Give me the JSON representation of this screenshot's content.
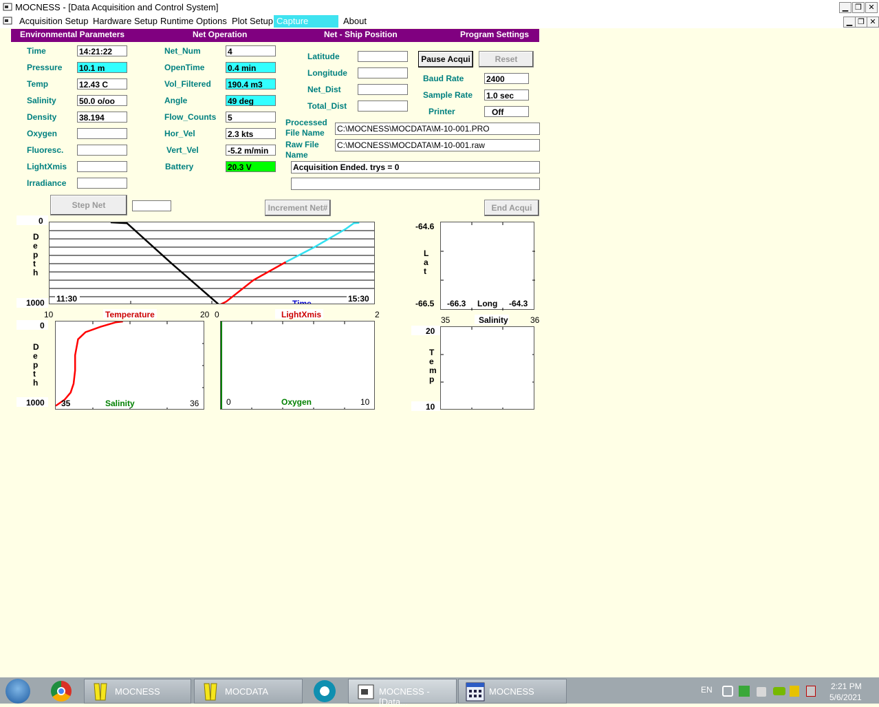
{
  "window": {
    "title": "MOCNESS - [Data Acquisition and Control System]"
  },
  "menu": [
    "Acquisition Setup",
    "Hardware Setup",
    "Runtime Options",
    "Plot Setup",
    "Capture Screen",
    "About"
  ],
  "sections": {
    "env": "Environmental Parameters",
    "net": "Net Operation",
    "ship": "Net - Ship Position",
    "prog": "Program Settings"
  },
  "env": {
    "labels": [
      "Time",
      "Pressure",
      "Temp",
      "Salinity",
      "Density",
      "Oxygen",
      "Fluoresc.",
      "LightXmis",
      "Irradiance"
    ],
    "values": [
      "14:21:22",
      "10.1 m",
      "12.43 C",
      "50.0 o/oo",
      "38.194",
      "",
      "",
      "",
      ""
    ]
  },
  "net": {
    "labels": [
      "Net_Num",
      "OpenTime",
      "Vol_Filtered",
      "Angle",
      "Flow_Counts",
      "Hor_Vel",
      "Vert_Vel",
      "Battery"
    ],
    "values": [
      "4",
      "0.4 min",
      "190.4 m3",
      "49 deg",
      "5",
      "2.3 kts",
      "-5.2 m/min",
      "20.3 V"
    ]
  },
  "ship": {
    "labels": [
      "Latitude",
      "Longitude",
      "Net_Dist",
      "Total_Dist"
    ],
    "values": [
      "",
      "",
      "",
      ""
    ]
  },
  "prog": {
    "pause_label": "Pause Acqui",
    "reset_label": "Reset",
    "baud_label": "Baud Rate",
    "baud_value": "2400",
    "sample_label": "Sample Rate",
    "sample_value": "1.0 sec",
    "printer_label": "Printer",
    "printer_value": "Off"
  },
  "files": {
    "processed_label_1": "Processed",
    "processed_label_2": "File Name",
    "processed_value": "C:\\MOCNESS\\MOCDATA\\M-10-001.PRO",
    "raw_label_1": "Raw File",
    "raw_label_2": "Name",
    "raw_value": "C:\\MOCNESS\\MOCDATA\\M-10-001.raw",
    "status": "Acquisition Ended.  trys = 0",
    "status2": ""
  },
  "buttons": {
    "step_net": "Step Net",
    "step_value": "",
    "increment": "Increment Net#",
    "end_acqui": "End Acqui"
  },
  "plots": {
    "depth_time": {
      "y_top": "0",
      "y_bottom": "1000",
      "y_label": "Depth",
      "x_left": "11:30",
      "x_right": "15:30",
      "x_label": "Time"
    },
    "lat_long": {
      "y_top": "-64.6",
      "y_bottom": "-66.5",
      "y_label": "Lat",
      "x_left": "-66.3",
      "x_right": "-64.3",
      "x_label": "Long"
    },
    "temp_sal": {
      "x_left": "35",
      "x_right": "36",
      "x_label": "Salinity",
      "y_top": "20",
      "y_bottom": "10",
      "y_label": "Temp"
    },
    "temp_depth": {
      "top_left": "10",
      "top_label": "Temperature",
      "top_right": "20",
      "y_top": "0",
      "y_bottom": "1000",
      "y_label": "Depth",
      "x_left": "35",
      "x_label": "Salinity",
      "x_right": "36"
    },
    "light_oxy": {
      "top_left": "0",
      "top_label": "LightXmis",
      "top_right": "2",
      "x_left": "0",
      "x_label": "Oxygen",
      "x_right": "10"
    }
  },
  "chart_data": [
    {
      "type": "line",
      "title": "",
      "xlabel": "Time",
      "ylabel": "Depth",
      "xlim": [
        "11:30",
        "15:30"
      ],
      "ylim": [
        0,
        1000
      ],
      "series": [
        {
          "color": "#000000",
          "x": [
            "12:15",
            "12:27",
            "13:00",
            "13:35"
          ],
          "y": [
            0,
            10,
            500,
            1000
          ]
        },
        {
          "color": "#FF0000",
          "x": [
            "13:35",
            "13:40",
            "14:00",
            "14:24"
          ],
          "y": [
            1000,
            960,
            700,
            480
          ]
        },
        {
          "color": "#33E0F0",
          "x": [
            "14:24",
            "14:45",
            "15:08",
            "15:14",
            "15:18"
          ],
          "y": [
            480,
            300,
            80,
            10,
            5
          ]
        }
      ]
    },
    {
      "type": "line",
      "title": "",
      "xlabel": "Salinity",
      "ylabel": "Depth",
      "xlim": [
        35,
        36
      ],
      "ylim": [
        0,
        1000
      ],
      "series": [
        {
          "color": "#FF0000",
          "x": [
            35.0,
            35.06,
            35.1,
            35.12,
            35.13,
            35.13,
            35.15,
            35.2,
            35.3,
            35.4,
            35.45
          ],
          "y": [
            950,
            880,
            800,
            700,
            550,
            380,
            200,
            120,
            60,
            10,
            0
          ]
        }
      ]
    }
  ],
  "taskbar": {
    "items": [
      "MOCNESS",
      "MOCDATA",
      "MOCNESS - [Data...",
      "MOCNESS"
    ],
    "lang": "EN",
    "time": "2:21 PM",
    "date": "5/6/2021"
  }
}
